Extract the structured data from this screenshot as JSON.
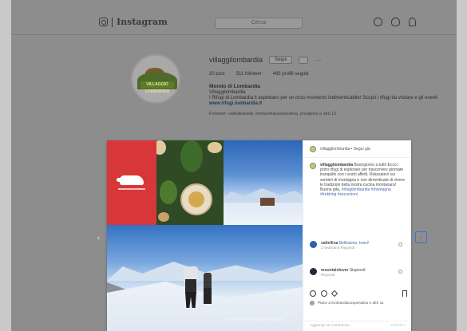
{
  "header": {
    "logo_text": "Instagram",
    "search_placeholder": "Cerca",
    "icons": [
      "compass-icon",
      "heart-icon",
      "person-icon"
    ]
  },
  "profile": {
    "avatar_text": "VILLAGGIO LOMBARDIA",
    "username": "villaggilombardia",
    "follow_label": "Segui",
    "stats": [
      "20 post",
      "511 follower",
      "493 profili seguiti"
    ],
    "bio_name": "Mondo di Lombardia",
    "bio_line1": "Villaggilombardia",
    "bio_line2": "I Rifugi di Lombardia ti aspettano per un ricco momento indimenticabile! Scopri i rifugi da visitare e gli eventi",
    "bio_link": "www.rifugi.lombardia.it",
    "followed_by": "Follower: valtellinaweb, lombardiacooperativa, prealpine e altri 12"
  },
  "post": {
    "image_caption": "Benvenuti nei rifugi lombardi",
    "header_name": "villaggilombardia • Segui già",
    "text_user": "villaggilombardia",
    "text_body": "Buongiorno a tutti! Ecco i primi rifugi di esplorare per trascorrere giornate tranquille con i vostri affetti. Rilassatevi sui sentieri di montagna e non dimenticate di vivere le tradizioni della nostra cucina montanara! Buona gita,",
    "text_tags": "#rifugilombardia #montagna #trekking #escursioni",
    "comments": [
      {
        "user": "valtellina",
        "text": "Bellissimo, bravi!",
        "meta": "2 settimane   Rispondi"
      },
      {
        "user": "mountainlover",
        "text": "Stupendi",
        "meta": "Rispondi"
      }
    ],
    "likes_text": "Piace a lombardiacooperativa e altri 11",
    "add_comment_placeholder": "Aggiungi un commento...",
    "publish_label": "Pubblica"
  },
  "colors": {
    "overlay_bg": "#8d8d8d",
    "brand_red": "#d8373a",
    "link_blue": "#4a67a8",
    "focus_blue": "#3c74d8"
  }
}
